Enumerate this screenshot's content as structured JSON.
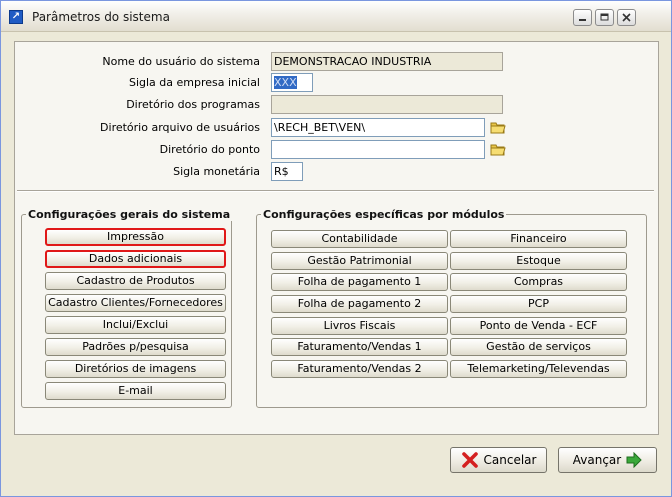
{
  "window": {
    "title": "Parâmetros do sistema"
  },
  "form": {
    "user_name_label": "Nome do usuário do sistema",
    "user_name_value": "DEMONSTRACAO INDUSTRIA",
    "company_code_label": "Sigla da empresa inicial",
    "company_code_value": "XXX",
    "programs_dir_label": "Diretório dos programas",
    "programs_dir_value": "",
    "users_dir_label": "Diretório arquivo de usuários",
    "users_dir_value": "\\RECH_BET\\VEN\\",
    "punch_dir_label": "Diretório do ponto",
    "punch_dir_value": "",
    "currency_label": "Sigla monetária",
    "currency_value": "R$"
  },
  "general": {
    "title": "Configurações gerais do sistema",
    "buttons": [
      "Impressão",
      "Dados adicionais",
      "Cadastro de Produtos",
      "Cadastro Clientes/Fornecedores",
      "Inclui/Exclui",
      "Padrões p/pesquisa",
      "Diretórios de imagens",
      "E-mail"
    ]
  },
  "modules": {
    "title": "Configurações específicas por módulos",
    "left": [
      "Contabilidade",
      "Gestão Patrimonial",
      "Folha de pagamento 1",
      "Folha de pagamento 2",
      "Livros Fiscais",
      "Faturamento/Vendas 1",
      "Faturamento/Vendas 2"
    ],
    "right": [
      "Financeiro",
      "Estoque",
      "Compras",
      "PCP",
      "Ponto de Venda - ECF",
      "Gestão de serviços",
      "Telemarketing/Televendas"
    ]
  },
  "footer": {
    "cancel_label": "Cancelar",
    "next_label": "Avançar"
  },
  "colors": {
    "highlight_border": "#e01818",
    "selection": "#316ac5"
  },
  "icons": {
    "app": "app-arrow-icon",
    "folder": "folder-icon",
    "cancel": "red-x-icon",
    "next": "green-arrow-icon"
  }
}
